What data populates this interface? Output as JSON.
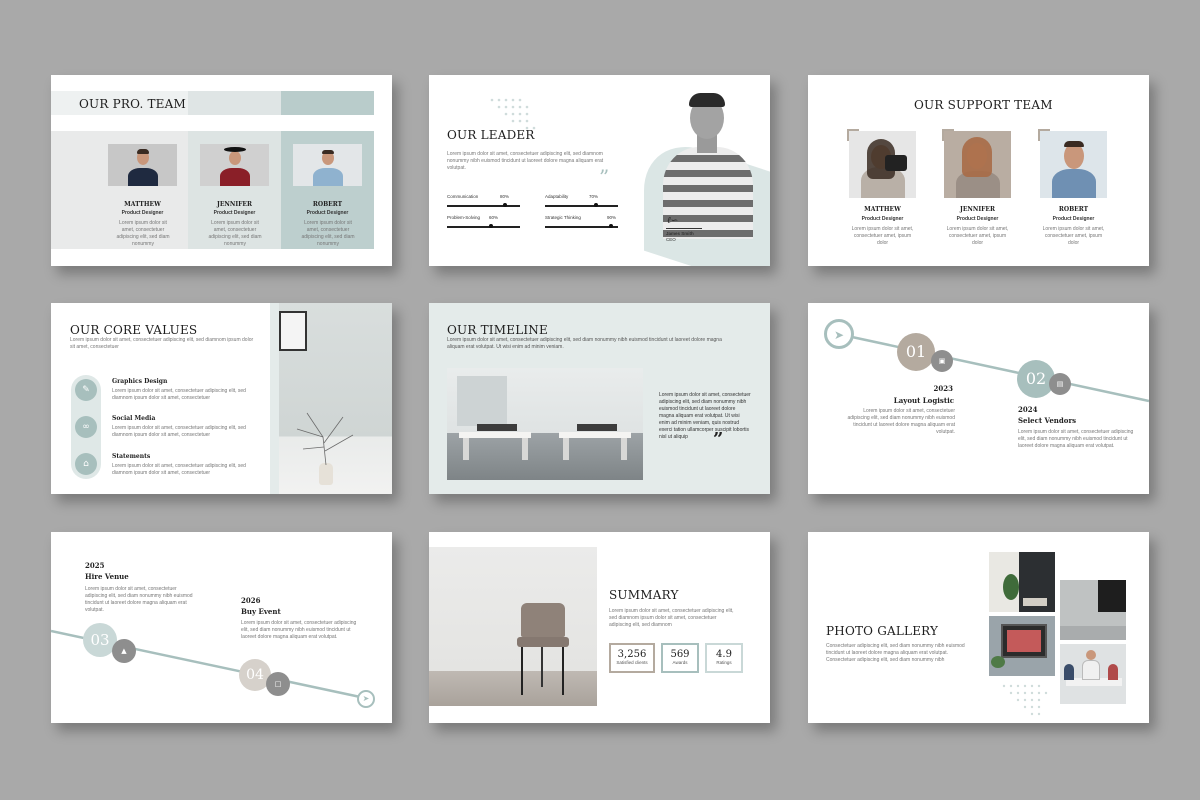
{
  "lorem": {
    "a": "Lorem ipsum dolor sit amet, consectetuer adipiscing elit, sed diamnom",
    "b": "nonummy nibh euismod tincidunt ut laoreet dolore magna aliquam erat volutpat. Ut wisi enim ad minim veniam.",
    "team": "Lorem ipsum dolor sit amet, consectetuer adipiscing elit, sed diam nonummy",
    "support": "Lorem ipsum dolor sit amet, consectetuer amet, ipsum dolor",
    "value": "Lorem ipsum dolor sit amet, consectetuer adipiscing elit, sed diamnom ipsum dolor sit amet, consectetuer",
    "quote": "Lorem ipsum dolor sit amet, consectetuer adipiscing elit, sed diam nonummy nibh euismod tincidunt ut laoreet dolore magna aliquam erat volutpat. Ut wisi enim ad minim veniam, quis nostrud exerci tation ullamcorper suscipit lobortis nisl ut aliquip",
    "step": "Lorem ipsum dolor sit amet, consectetuer adipiscing elit, sed diam nonummy nibh euismod tincidunt ut laoreet dolore magna aliquam erat volutpat."
  },
  "slide1": {
    "title": "OUR PRO. TEAM",
    "members": [
      {
        "name": "MATTHEW",
        "role": "Product Designer",
        "desc": "Lorem ipsum dolor sit amet, consectetuer adipiscing elit, sed diam nonummy"
      },
      {
        "name": "JENNIFER",
        "role": "Product Designer",
        "desc": "Lorem ipsum dolor sit amet, consectetuer adipiscing elit, sed diam nonummy"
      },
      {
        "name": "ROBERT",
        "role": "Product Designer",
        "desc": "Lorem ipsum dolor sit amet, consectetuer adipiscing elit, sed diam nonummy"
      }
    ]
  },
  "slide2": {
    "title": "OUR LEADER",
    "text": "Lorem ipsum dolor sit amet, consectetuer adipiscing elit, sed diamnom nonummy nibh euismod tincidunt ut laoreet dolore magna aliquam erat volutpat.",
    "skills": [
      {
        "label": "Communication",
        "value": "80%",
        "level": 0.8
      },
      {
        "label": "Adaptability",
        "value": "70%",
        "level": 0.7
      },
      {
        "label": "Problem-Solving",
        "value": "60%",
        "level": 0.6
      },
      {
        "label": "Strategic Thinking",
        "value": "90%",
        "level": 0.9
      }
    ],
    "leader_name": "James Smith",
    "leader_role": "CEO"
  },
  "slide3": {
    "title": "OUR SUPPORT TEAM",
    "members": [
      {
        "name": "MATTHEW",
        "role": "Product Designer",
        "desc": "Lorem ipsum dolor sit amet, consectetuer amet, ipsum dolor"
      },
      {
        "name": "JENNIFER",
        "role": "Product Designer",
        "desc": "Lorem ipsum dolor sit amet, consectetuer amet, ipsum dolor"
      },
      {
        "name": "ROBERT",
        "role": "Product Designer",
        "desc": "Lorem ipsum dolor sit amet, consectetuer amet, ipsum dolor"
      }
    ]
  },
  "slide4": {
    "title": "OUR CORE VALUES",
    "intro": "Lorem ipsum dolor sit amet, consectetuer adipiscing elit, sed diamnom ipsum dolor sit amet, consectetuer",
    "values": [
      {
        "label": "Graphics Design",
        "desc": "Lorem ipsum dolor sit amet, consectetuer adipiscing elit, sed diamnom ipsum dolor sit amet, consectetuer"
      },
      {
        "label": "Social Media",
        "desc": "Lorem ipsum dolor sit amet, consectetuer adipiscing elit, sed diamnom ipsum dolor sit amet, consectetuer"
      },
      {
        "label": "Statements",
        "desc": "Lorem ipsum dolor sit amet, consectetuer adipiscing elit, sed diamnom ipsum dolor sit amet, consectetuer"
      }
    ]
  },
  "slide5": {
    "title": "OUR TIMELINE",
    "text": "Lorem ipsum dolor sit amet, consectetuer adipiscing elit, sed diam nonummy nibh euismod tincidunt ut laoreet dolore magna aliquam erat volutpat. Ut wisi enim ad minim veniam.",
    "quote": "Lorem ipsum dolor sit amet, consectetuer adipiscing elit, sed diam nonummy nibh euismod tincidunt ut laoreet dolore magna aliquam erat volutpat. Ut wisi enim ad minim veniam, quis nostrud exerci tation ullamcorper suscipit lobortis nisl ut aliquip"
  },
  "slide6": {
    "steps": [
      {
        "num": "01",
        "year": "2023",
        "label": "Layout Logistic",
        "desc": "Lorem ipsum dolor sit amet, consectetuer adipiscing elit, sed diam nonummy nibh euismod tincidunt ut laoreet dolore magna aliquam erat volutpat."
      },
      {
        "num": "02",
        "year": "2024",
        "label": "Select Vendors",
        "desc": "Lorem ipsum dolor sit amet, consectetuer adipiscing elit, sed diam nonummy nibh euismod tincidunt ut laoreet dolore magna aliquam erat volutpat."
      }
    ]
  },
  "slide7": {
    "steps": [
      {
        "num": "03",
        "year": "2025",
        "label": "Hire Venue",
        "desc": "Lorem ipsum dolor sit amet, consectetuer adipiscing elit, sed diam nonummy nibh euismod tincidunt ut laoreet dolore magna aliquam erat volutpat."
      },
      {
        "num": "04",
        "year": "2026",
        "label": "Buy Event",
        "desc": "Lorem ipsum dolor sit amet, consectetuer adipiscing elit, sed diam nonummy nibh euismod tincidunt ut laoreet dolore magna aliquam erat volutpat."
      }
    ]
  },
  "slide8": {
    "title": "SUMMARY",
    "text": "Lorem ipsum dolor sit amet, consectetuer adipiscing elit, sed diamnom ipsum dolor sit amet, consectetuer adipiscing elit, sed diamnom",
    "stats": [
      {
        "value": "3,256",
        "label": "Satisfied clients"
      },
      {
        "value": "569",
        "label": "Awards"
      },
      {
        "value": "4.9",
        "label": "Ratings"
      }
    ]
  },
  "slide9": {
    "title": "PHOTO GALLERY",
    "text": "Consectetuer adipiscing elit, sed diam nonummy nibh euismod tincidunt ut laoreet dolore magna aliquam erat volutpat. Consectetuer adipiscing elit, sed diam nonummy nibh"
  },
  "colors": {
    "background": "#a9a9a9",
    "accent": "#a7bfbd",
    "light": "#e4ebea",
    "taupe": "#b4aa9f"
  },
  "icons": [
    "pen-icon",
    "share-icon",
    "bank-icon",
    "paper-plane-icon",
    "truck-icon",
    "store-icon",
    "tent-icon",
    "calendar-icon",
    "quote-icon"
  ]
}
